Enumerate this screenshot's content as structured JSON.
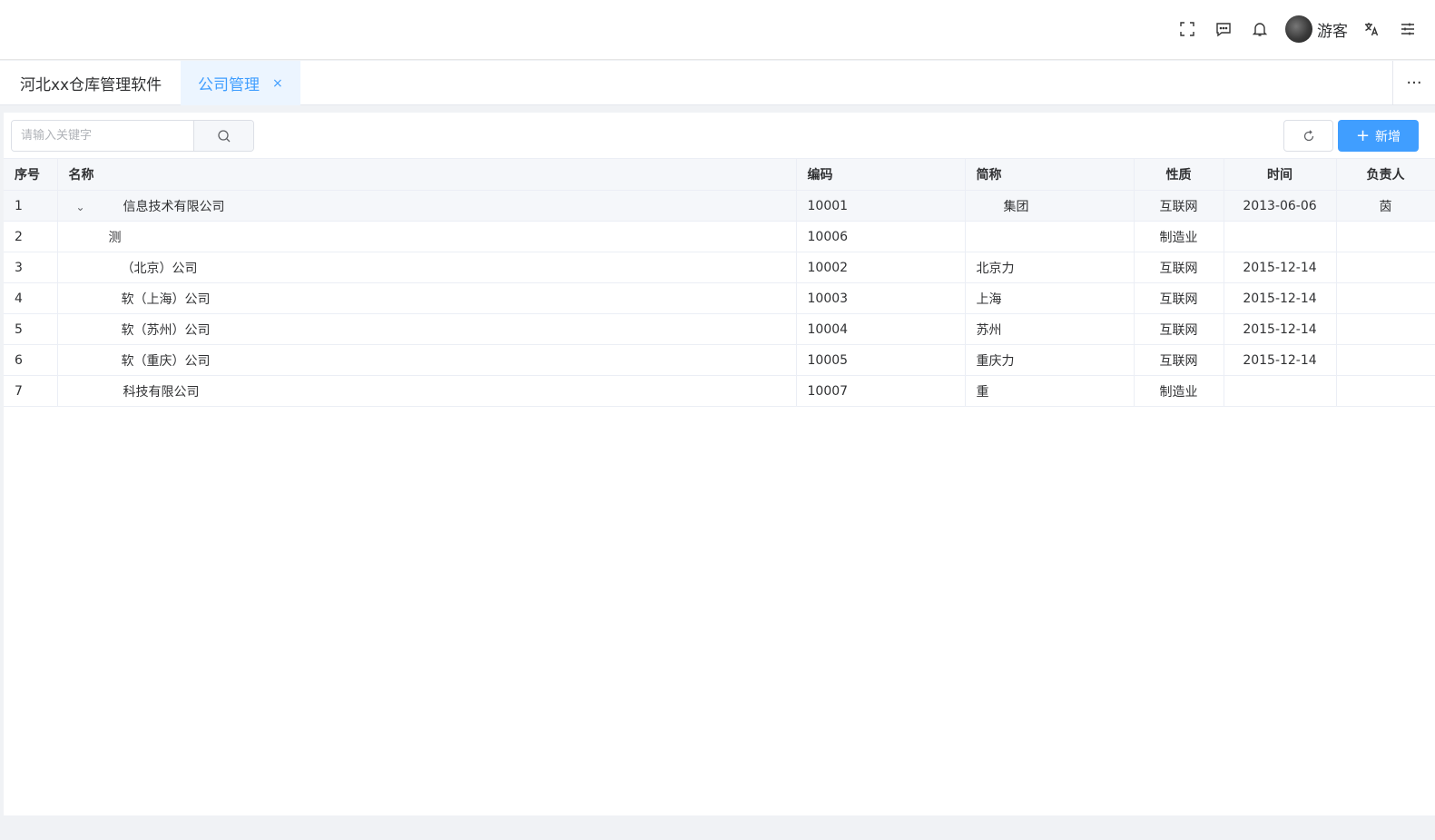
{
  "header": {
    "username": "游客",
    "icons": [
      "fullscreen-icon",
      "message-icon",
      "bell-icon",
      "translate-icon",
      "settings-sliders-icon"
    ]
  },
  "tabs": {
    "home": "河北xx仓库管理软件",
    "active": "公司管理",
    "close": "×",
    "more": "···"
  },
  "toolbar": {
    "search_placeholder": "请输入关键字",
    "add_label": "新增"
  },
  "table": {
    "columns": [
      "序号",
      "名称",
      "编码",
      "简称",
      "性质",
      "时间",
      "负责人"
    ],
    "rows": [
      {
        "idx": "1",
        "name": "信息技术有限公司",
        "code": "10001",
        "short": "集团",
        "type": "互联网",
        "date": "2013-06-06",
        "owner": "茵"
      },
      {
        "idx": "2",
        "name": "测",
        "code": "10006",
        "short": "",
        "type": "制造业",
        "date": "",
        "owner": ""
      },
      {
        "idx": "3",
        "name": "（北京）公司",
        "code": "10002",
        "short": "北京力",
        "type": "互联网",
        "date": "2015-12-14",
        "owner": ""
      },
      {
        "idx": "4",
        "name": "软（上海）公司",
        "code": "10003",
        "short": "上海",
        "type": "互联网",
        "date": "2015-12-14",
        "owner": ""
      },
      {
        "idx": "5",
        "name": "软（苏州）公司",
        "code": "10004",
        "short": "苏州",
        "type": "互联网",
        "date": "2015-12-14",
        "owner": ""
      },
      {
        "idx": "6",
        "name": "软（重庆）公司",
        "code": "10005",
        "short": "重庆力",
        "type": "互联网",
        "date": "2015-12-14",
        "owner": ""
      },
      {
        "idx": "7",
        "name": "科技有限公司",
        "code": "10007",
        "short": "重",
        "type": "制造业",
        "date": "",
        "owner": ""
      }
    ]
  },
  "colors": {
    "accent": "#409eff",
    "active_tab_bg": "#ecf5ff",
    "header_bg": "#f5f7fa"
  }
}
